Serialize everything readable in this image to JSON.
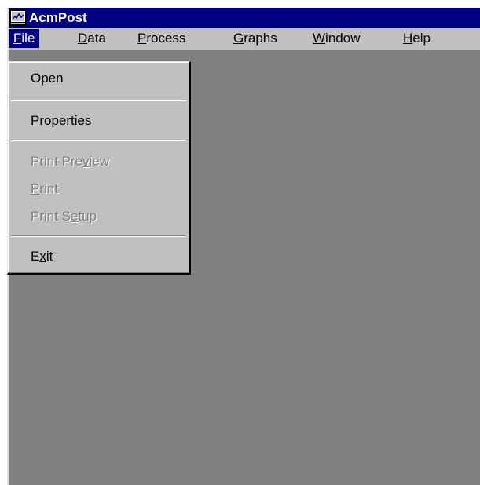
{
  "window": {
    "title": "AcmPost",
    "icon": "acmpost-app-icon"
  },
  "menu_bar": {
    "items": [
      {
        "underline": "F",
        "rest": "ile",
        "active": true
      },
      {
        "underline": "D",
        "rest": "ata"
      },
      {
        "underline": "P",
        "rest": "rocess"
      },
      {
        "underline": "G",
        "rest": "raphs"
      },
      {
        "underline": "W",
        "rest": "indow"
      },
      {
        "underline": "H",
        "rest": "elp"
      }
    ]
  },
  "file_menu": {
    "open": {
      "label": "Open",
      "enabled": true
    },
    "properties": {
      "pre": "Pr",
      "underline": "o",
      "post": "perties",
      "enabled": true
    },
    "print_preview": {
      "pre": "Print Pre",
      "underline": "v",
      "post": "iew",
      "enabled": false
    },
    "print": {
      "pre": "",
      "underline": "P",
      "post": "rint",
      "enabled": false
    },
    "print_setup": {
      "pre": "Print S",
      "underline": "e",
      "post": "tup",
      "enabled": false
    },
    "exit": {
      "pre": "E",
      "underline": "x",
      "post": "it",
      "enabled": true
    }
  },
  "colors": {
    "title_bar": "#000080",
    "menu_face": "#c0c0c0",
    "client_area": "#808080",
    "disabled_text": "#808080"
  }
}
